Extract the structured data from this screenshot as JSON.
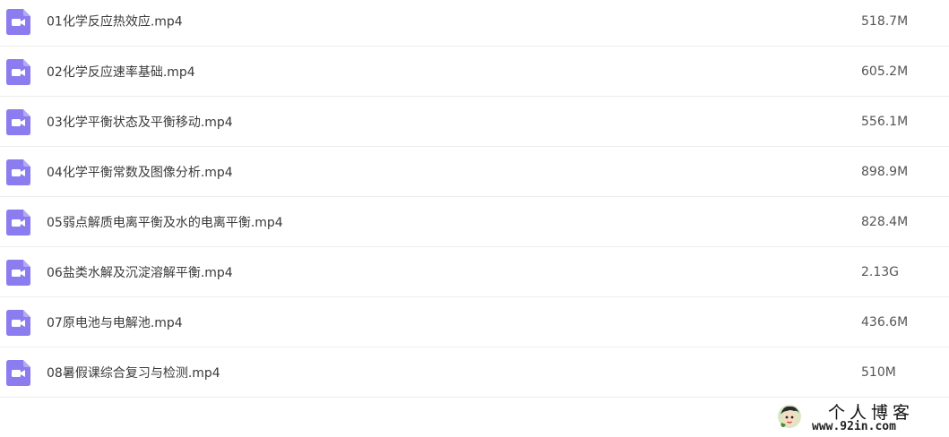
{
  "files": [
    {
      "name": "01化学反应热效应.mp4",
      "size": "518.7M",
      "icon": "video-file-icon"
    },
    {
      "name": "02化学反应速率基础.mp4",
      "size": "605.2M",
      "icon": "video-file-icon"
    },
    {
      "name": "03化学平衡状态及平衡移动.mp4",
      "size": "556.1M",
      "icon": "video-file-icon"
    },
    {
      "name": "04化学平衡常数及图像分析.mp4",
      "size": "898.9M",
      "icon": "video-file-icon"
    },
    {
      "name": "05弱点解质电离平衡及水的电离平衡.mp4",
      "size": "828.4M",
      "icon": "video-file-icon"
    },
    {
      "name": "06盐类水解及沉淀溶解平衡.mp4",
      "size": "2.13G",
      "icon": "video-file-icon"
    },
    {
      "name": "07原电池与电解池.mp4",
      "size": "436.6M",
      "icon": "video-file-icon"
    },
    {
      "name": "08暑假课综合复习与检测.mp4",
      "size": "510M",
      "icon": "video-file-icon"
    }
  ],
  "watermark": {
    "title": "个人博客",
    "url": "www.92in.com"
  },
  "colors": {
    "icon": "#8b7cf0",
    "divider": "#ececec",
    "text": "#3a3a3a"
  }
}
